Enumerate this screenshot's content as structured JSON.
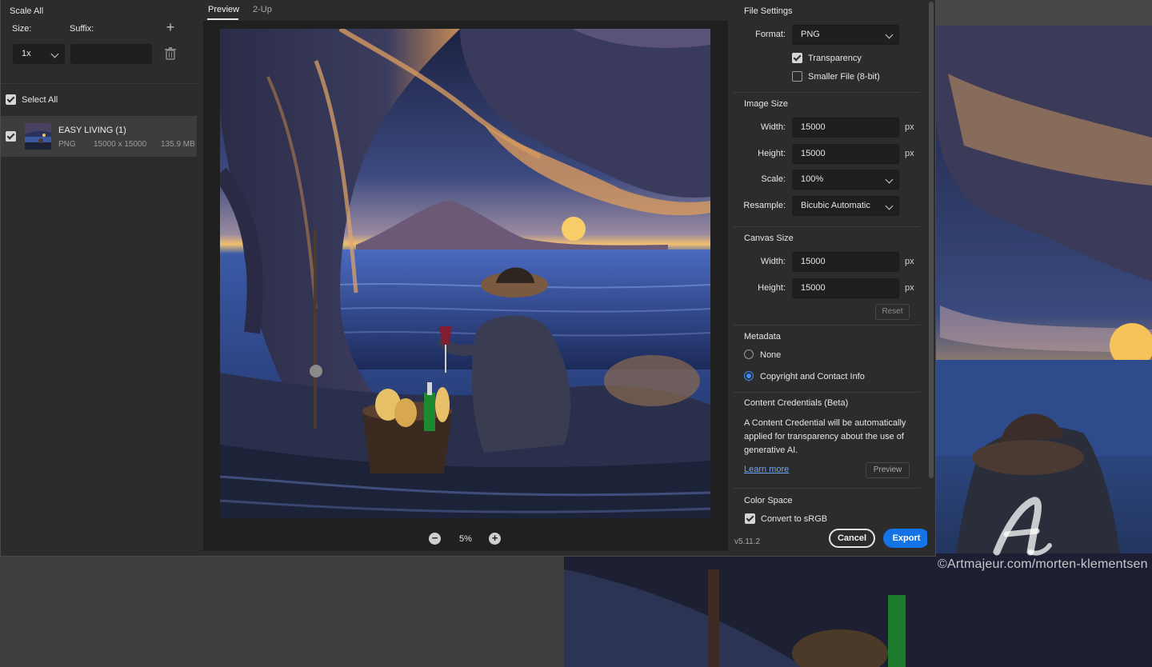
{
  "export_dialog": {
    "left": {
      "scale_all": "Scale All",
      "size_label": "Size:",
      "suffix_label": "Suffix:",
      "size_value": "1x",
      "suffix_value": "",
      "select_all": "Select All",
      "asset": {
        "name": "EASY LIVING (1)",
        "format": "PNG",
        "dimensions": "15000 x 15000",
        "filesize": "135.9 MB"
      }
    },
    "center": {
      "tabs": [
        "Preview",
        "2-Up"
      ],
      "zoom": "5%"
    },
    "right": {
      "file_settings": "File Settings",
      "format_label": "Format:",
      "format_value": "PNG",
      "transparency": "Transparency",
      "smaller_file": "Smaller File (8-bit)",
      "image_size": "Image Size",
      "width_label": "Width:",
      "height_label": "Height:",
      "scale_label": "Scale:",
      "resample_label": "Resample:",
      "img_width": "15000",
      "img_height": "15000",
      "scale_value": "100%",
      "resample_value": "Bicubic Automatic",
      "unit": "px",
      "canvas_size": "Canvas Size",
      "canvas_width": "15000",
      "canvas_height": "15000",
      "reset": "Reset",
      "metadata": "Metadata",
      "meta_none": "None",
      "meta_copyright": "Copyright and Contact Info",
      "content_credentials": "Content Credentials (Beta)",
      "cc_text": "A Content Credential will be automatically applied for transparency about the use of generative AI.",
      "learn_more": "Learn more",
      "preview_btn": "Preview",
      "color_space": "Color Space",
      "convert_srgb": "Convert to sRGB",
      "version": "v5.11.2",
      "cancel": "Cancel",
      "export": "Export"
    }
  },
  "background": {
    "watermark": "©Artmajeur.com/morten-klementsen"
  }
}
